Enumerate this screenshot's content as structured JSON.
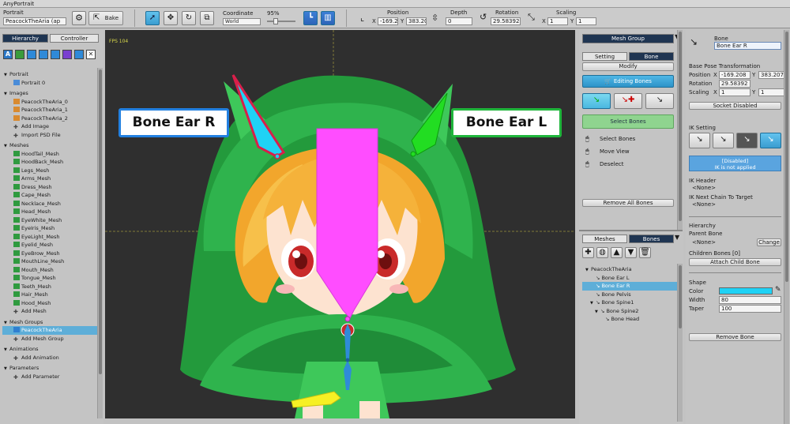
{
  "app": {
    "title": "AnyPortrait"
  },
  "toolbar": {
    "portrait_label": "Portrait",
    "portrait_value": "PeacockTheAria (ap",
    "bake_label": "Bake",
    "coordinate_label": "Coordinate",
    "coordinate_value": "World",
    "zoom_value": "95%",
    "position_label": "Position",
    "position_x_label": "X",
    "position_x": "-169.20",
    "position_y_label": "Y",
    "position_y": "383.20",
    "depth_label": "Depth",
    "depth_value": "0",
    "rotation_label": "Rotation",
    "rotation_value": "29.58392",
    "scaling_label": "Scaling",
    "scaling_x_label": "X",
    "scaling_x": "1",
    "scaling_y_label": "Y",
    "scaling_y": "1"
  },
  "left": {
    "tabs": [
      "Hierarchy",
      "Controller"
    ],
    "filter_icons": [
      "A",
      "",
      "",
      "",
      "",
      "",
      "",
      ""
    ],
    "rows": [
      {
        "text": "Portrait",
        "type": "header"
      },
      {
        "text": "Portrait 0",
        "type": "item"
      },
      {
        "text": "Images",
        "type": "header"
      },
      {
        "text": "PeacockTheAria_0",
        "type": "image"
      },
      {
        "text": "PeacockTheAria_1",
        "type": "image"
      },
      {
        "text": "PeacockTheAria_2",
        "type": "image"
      },
      {
        "text": "Add Image",
        "type": "add"
      },
      {
        "text": "Import PSD File",
        "type": "add"
      },
      {
        "text": "Meshes",
        "type": "header"
      },
      {
        "text": "HoodTail_Mesh",
        "type": "mesh"
      },
      {
        "text": "HoodBack_Mesh",
        "type": "mesh"
      },
      {
        "text": "Legs_Mesh",
        "type": "mesh"
      },
      {
        "text": "Arms_Mesh",
        "type": "mesh"
      },
      {
        "text": "Dress_Mesh",
        "type": "mesh"
      },
      {
        "text": "Cape_Mesh",
        "type": "mesh"
      },
      {
        "text": "Necklace_Mesh",
        "type": "mesh"
      },
      {
        "text": "Head_Mesh",
        "type": "mesh"
      },
      {
        "text": "EyeWhite_Mesh",
        "type": "mesh"
      },
      {
        "text": "EyeIris_Mesh",
        "type": "mesh"
      },
      {
        "text": "EyeLight_Mesh",
        "type": "mesh"
      },
      {
        "text": "Eyelid_Mesh",
        "type": "mesh"
      },
      {
        "text": "EyeBrow_Mesh",
        "type": "mesh"
      },
      {
        "text": "MouthLine_Mesh",
        "type": "mesh"
      },
      {
        "text": "Mouth_Mesh",
        "type": "mesh"
      },
      {
        "text": "Tongue_Mesh",
        "type": "mesh"
      },
      {
        "text": "Teeth_Mesh",
        "type": "mesh"
      },
      {
        "text": "Hair_Mesh",
        "type": "mesh"
      },
      {
        "text": "Hood_Mesh",
        "type": "mesh"
      },
      {
        "text": "Add Mesh",
        "type": "add"
      },
      {
        "text": "Mesh Groups",
        "type": "header"
      },
      {
        "text": "PeacockTheAria",
        "type": "meshgroup",
        "selected": true
      },
      {
        "text": "Add Mesh Group",
        "type": "add"
      },
      {
        "text": "Animations",
        "type": "header"
      },
      {
        "text": "Add Animation",
        "type": "add"
      },
      {
        "text": "Parameters",
        "type": "header"
      },
      {
        "text": "Add Parameter",
        "type": "add"
      }
    ]
  },
  "viewport": {
    "fps": "FPS 104",
    "callout_r": "Bone Ear R",
    "callout_l": "Bone Ear L"
  },
  "middle": {
    "header": "Mesh Group",
    "tabs": [
      "Setting",
      "Bone"
    ],
    "modify": "Modify",
    "editing": "Editing Bones",
    "select_bones_btn": "Select Bones",
    "hints": [
      "Select Bones",
      "Move View",
      "Deselect"
    ],
    "remove_all": "Remove All Bones",
    "bottom_tabs": [
      "Meshes",
      "Bones"
    ],
    "bones": [
      {
        "text": "PeacockTheAria",
        "depth": 0
      },
      {
        "text": "Bone Ear L",
        "depth": 1
      },
      {
        "text": "Bone Ear R",
        "depth": 1,
        "selected": true
      },
      {
        "text": "Bone Pelvis",
        "depth": 1
      },
      {
        "text": "Bone Spine1",
        "depth": 1
      },
      {
        "text": "Bone Spine2",
        "depth": 2
      },
      {
        "text": "Bone Head",
        "depth": 3
      }
    ]
  },
  "right": {
    "bone_label": "Bone",
    "bone_name": "Bone Ear R",
    "base_pose": "Base Pose Transformation",
    "position_label": "Position",
    "pos_x_label": "X",
    "pos_x": "-169.208",
    "pos_y_label": "Y",
    "pos_y": "383.2074",
    "rotation_label": "Rotation",
    "rotation": "29.58392",
    "scaling_label": "Scaling",
    "scale_x_label": "X",
    "scale_x": "1",
    "scale_y_label": "Y",
    "scale_y": "1",
    "socket": "Socket Disabled",
    "ik_setting": "IK Setting",
    "ik_disabled_1": "[Disabled]",
    "ik_disabled_2": "IK is not applied",
    "ik_header": "IK Header",
    "ik_header_val": "<None>",
    "ik_next": "IK Next Chain To Target",
    "ik_next_val": "<None>",
    "hierarchy": "Hierarchy",
    "parent_bone": "Parent Bone",
    "parent_val": "<None>",
    "change": "Change",
    "children": "Children Bones [0]",
    "attach": "Attach Child Bone",
    "shape": "Shape",
    "color_label": "Color",
    "color": "#1fd2f5",
    "width_label": "Width",
    "width": "80",
    "taper_label": "Taper",
    "taper": "100",
    "remove_bone": "Remove Bone"
  },
  "colors": {
    "selection": "#5eaed8",
    "header_dark": "#1f3552",
    "bone_pink": "#ff4dff",
    "bone_cyan": "#1fd2f5",
    "bone_green": "#22dd22",
    "bone_yellow": "#f6f024"
  }
}
